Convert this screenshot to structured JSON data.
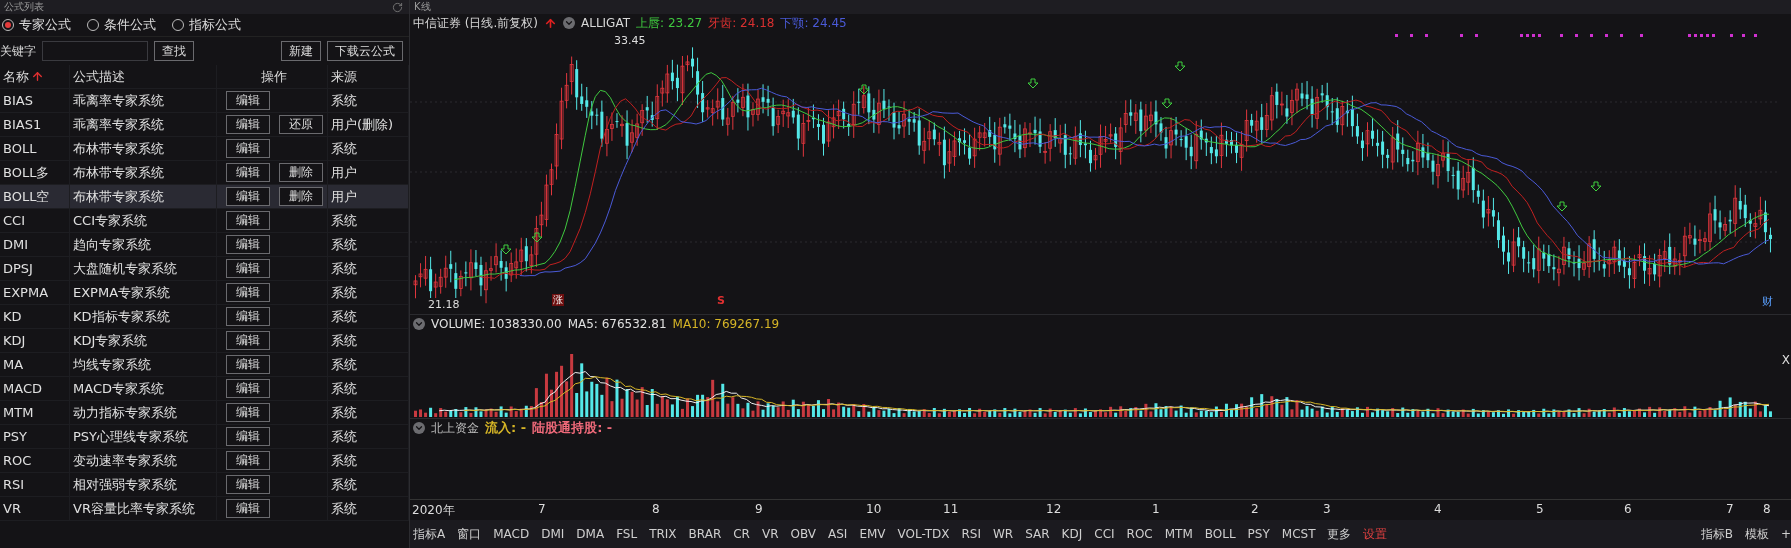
{
  "formula_panel": {
    "title": "公式列表",
    "formula_types": [
      {
        "label": "专家公式",
        "selected": true
      },
      {
        "label": "条件公式",
        "selected": false
      },
      {
        "label": "指标公式",
        "selected": false
      }
    ],
    "keyword_label": "关键字",
    "search_button": "查找",
    "new_button": "新建",
    "download_button": "下载云公式",
    "columns": [
      {
        "label": "名称",
        "sorted": true
      },
      {
        "label": "公式描述",
        "sorted": false
      },
      {
        "label": "操作",
        "sorted": false
      },
      {
        "label": "来源",
        "sorted": false
      }
    ],
    "rows": [
      {
        "name": "BIAS",
        "description": "乖离率专家系统",
        "actions": [
          "编辑"
        ],
        "source": "系统",
        "selected": false
      },
      {
        "name": "BIAS1",
        "description": "乖离率专家系统",
        "actions": [
          "编辑",
          "还原"
        ],
        "source": "用户(删除)",
        "selected": false
      },
      {
        "name": "BOLL",
        "description": "布林带专家系统",
        "actions": [
          "编辑"
        ],
        "source": "系统",
        "selected": false
      },
      {
        "name": "BOLL多",
        "description": "布林带专家系统",
        "actions": [
          "编辑",
          "删除"
        ],
        "source": "用户",
        "selected": false
      },
      {
        "name": "BOLL空",
        "description": "布林带专家系统",
        "actions": [
          "编辑",
          "删除"
        ],
        "source": "用户",
        "selected": true
      },
      {
        "name": "CCI",
        "description": "CCI专家系统",
        "actions": [
          "编辑"
        ],
        "source": "系统",
        "selected": false
      },
      {
        "name": "DMI",
        "description": "趋向专家系统",
        "actions": [
          "编辑"
        ],
        "source": "系统",
        "selected": false
      },
      {
        "name": "DPSJ",
        "description": "大盘随机专家系统",
        "actions": [
          "编辑"
        ],
        "source": "系统",
        "selected": false
      },
      {
        "name": "EXPMA",
        "description": "EXPMA专家系统",
        "actions": [
          "编辑"
        ],
        "source": "系统",
        "selected": false
      },
      {
        "name": "KD",
        "description": "KD指标专家系统",
        "actions": [
          "编辑"
        ],
        "source": "系统",
        "selected": false
      },
      {
        "name": "KDJ",
        "description": "KDJ专家系统",
        "actions": [
          "编辑"
        ],
        "source": "系统",
        "selected": false
      },
      {
        "name": "MA",
        "description": "均线专家系统",
        "actions": [
          "编辑"
        ],
        "source": "系统",
        "selected": false
      },
      {
        "name": "MACD",
        "description": "MACD专家系统",
        "actions": [
          "编辑"
        ],
        "source": "系统",
        "selected": false
      },
      {
        "name": "MTM",
        "description": "动力指标专家系统",
        "actions": [
          "编辑"
        ],
        "source": "系统",
        "selected": false
      },
      {
        "name": "PSY",
        "description": "PSY心理线专家系统",
        "actions": [
          "编辑"
        ],
        "source": "系统",
        "selected": false
      },
      {
        "name": "ROC",
        "description": "变动速率专家系统",
        "actions": [
          "编辑"
        ],
        "source": "系统",
        "selected": false
      },
      {
        "name": "RSI",
        "description": "相对强弱专家系统",
        "actions": [
          "编辑"
        ],
        "source": "系统",
        "selected": false
      },
      {
        "name": "VR",
        "description": "VR容量比率专家系统",
        "actions": [
          "编辑"
        ],
        "source": "系统",
        "selected": false
      }
    ]
  },
  "chart_panel": {
    "title": "K线",
    "stock": "中信证券 (日线.前复权)",
    "indicator": "ALLIGAT",
    "legend": [
      {
        "text": "上唇: 23.27",
        "color": "#3fc93f"
      },
      {
        "text": "牙齿: 24.18",
        "color": "#d93030"
      },
      {
        "text": "下颚: 24.45",
        "color": "#4a5ad8"
      }
    ],
    "high_label": "33.45",
    "low_label": "21.18",
    "markers": [
      {
        "text": "涨",
        "kind": "badge"
      },
      {
        "text": "S",
        "kind": "signal"
      },
      {
        "text": "财",
        "kind": "finance"
      }
    ],
    "volume_legend": [
      {
        "text": "VOLUME: 1038330.00",
        "color": "#e0e0e0"
      },
      {
        "text": "MA5: 676532.81",
        "color": "#e0e0e0"
      },
      {
        "text": "MA10: 769267.19",
        "color": "#d6b526"
      }
    ],
    "close_label": "X",
    "northbound_title": "北上资金",
    "northbound_legend": [
      {
        "text": "流入: -",
        "color": "#d6b526"
      },
      {
        "text": "陆股通持股: -",
        "color": "#f06a7a"
      }
    ],
    "date_axis": [
      "2020年",
      "7",
      "8",
      "9",
      "10",
      "11",
      "12",
      "1",
      "2",
      "3",
      "4",
      "5",
      "6",
      "7",
      "8"
    ],
    "bottom_tabs": [
      {
        "label": "指标A",
        "kind": "indicator"
      },
      {
        "label": "窗口",
        "kind": "indicator"
      },
      {
        "label": "MACD",
        "kind": "indicator"
      },
      {
        "label": "DMI",
        "kind": "indicator"
      },
      {
        "label": "DMA",
        "kind": "indicator"
      },
      {
        "label": "FSL",
        "kind": "indicator"
      },
      {
        "label": "TRIX",
        "kind": "indicator"
      },
      {
        "label": "BRAR",
        "kind": "indicator"
      },
      {
        "label": "CR",
        "kind": "indicator"
      },
      {
        "label": "VR",
        "kind": "indicator"
      },
      {
        "label": "OBV",
        "kind": "indicator"
      },
      {
        "label": "ASI",
        "kind": "indicator"
      },
      {
        "label": "EMV",
        "kind": "indicator"
      },
      {
        "label": "VOL-TDX",
        "kind": "indicator"
      },
      {
        "label": "RSI",
        "kind": "indicator"
      },
      {
        "label": "WR",
        "kind": "indicator"
      },
      {
        "label": "SAR",
        "kind": "indicator"
      },
      {
        "label": "KDJ",
        "kind": "indicator"
      },
      {
        "label": "CCI",
        "kind": "indicator"
      },
      {
        "label": "ROC",
        "kind": "indicator"
      },
      {
        "label": "MTM",
        "kind": "indicator"
      },
      {
        "label": "BOLL",
        "kind": "indicator"
      },
      {
        "label": "PSY",
        "kind": "indicator"
      },
      {
        "label": "MCST",
        "kind": "indicator"
      },
      {
        "label": "更多",
        "kind": "indicator"
      },
      {
        "label": "设置",
        "kind": "action"
      }
    ],
    "right_tabs": [
      "指标B",
      "模板",
      "+"
    ]
  }
}
